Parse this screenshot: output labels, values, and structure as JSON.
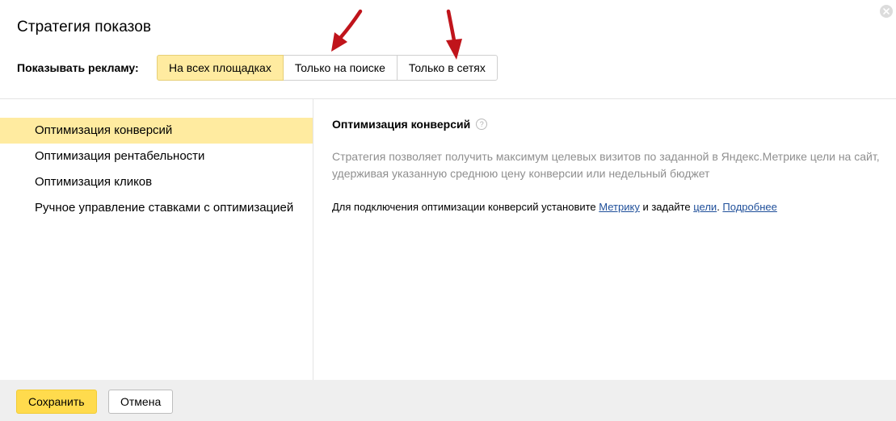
{
  "dialog": {
    "title": "Стратегия показов"
  },
  "show_ads": {
    "label": "Показывать рекламу:",
    "options": [
      {
        "label": "На всех площадках",
        "selected": true
      },
      {
        "label": "Только на поиске",
        "selected": false
      },
      {
        "label": "Только в сетях",
        "selected": false
      }
    ]
  },
  "strategies": {
    "items": [
      {
        "label": "Оптимизация конверсий",
        "selected": true
      },
      {
        "label": "Оптимизация рентабельности",
        "selected": false
      },
      {
        "label": "Оптимизация кликов",
        "selected": false
      },
      {
        "label": "Ручное управление ставками с оптимизацией",
        "selected": false
      }
    ]
  },
  "details": {
    "title": "Оптимизация конверсий",
    "help_icon": "?",
    "description": "Стратегия позволяет получить максимум целевых визитов по заданной в Яндекс.Метрике цели на сайт, удерживая указанную среднюю цену конверсии или недельный бюджет",
    "note_prefix": "Для подключения оптимизации конверсий установите ",
    "link_metrika": "Метрику",
    "note_middle": " и задайте ",
    "link_goals": "цели",
    "note_dot": ". ",
    "link_more": "Подробнее"
  },
  "footer": {
    "save_label": "Сохранить",
    "cancel_label": "Отмена"
  },
  "colors": {
    "accent_yellow": "#ffdb4d",
    "selected_bg": "#ffeba0",
    "link_blue": "#1f4f9a",
    "annotation_red": "#c0141b"
  },
  "icons": {
    "close": "close-icon",
    "help": "help-icon",
    "annotation": "arrow-annotation"
  }
}
